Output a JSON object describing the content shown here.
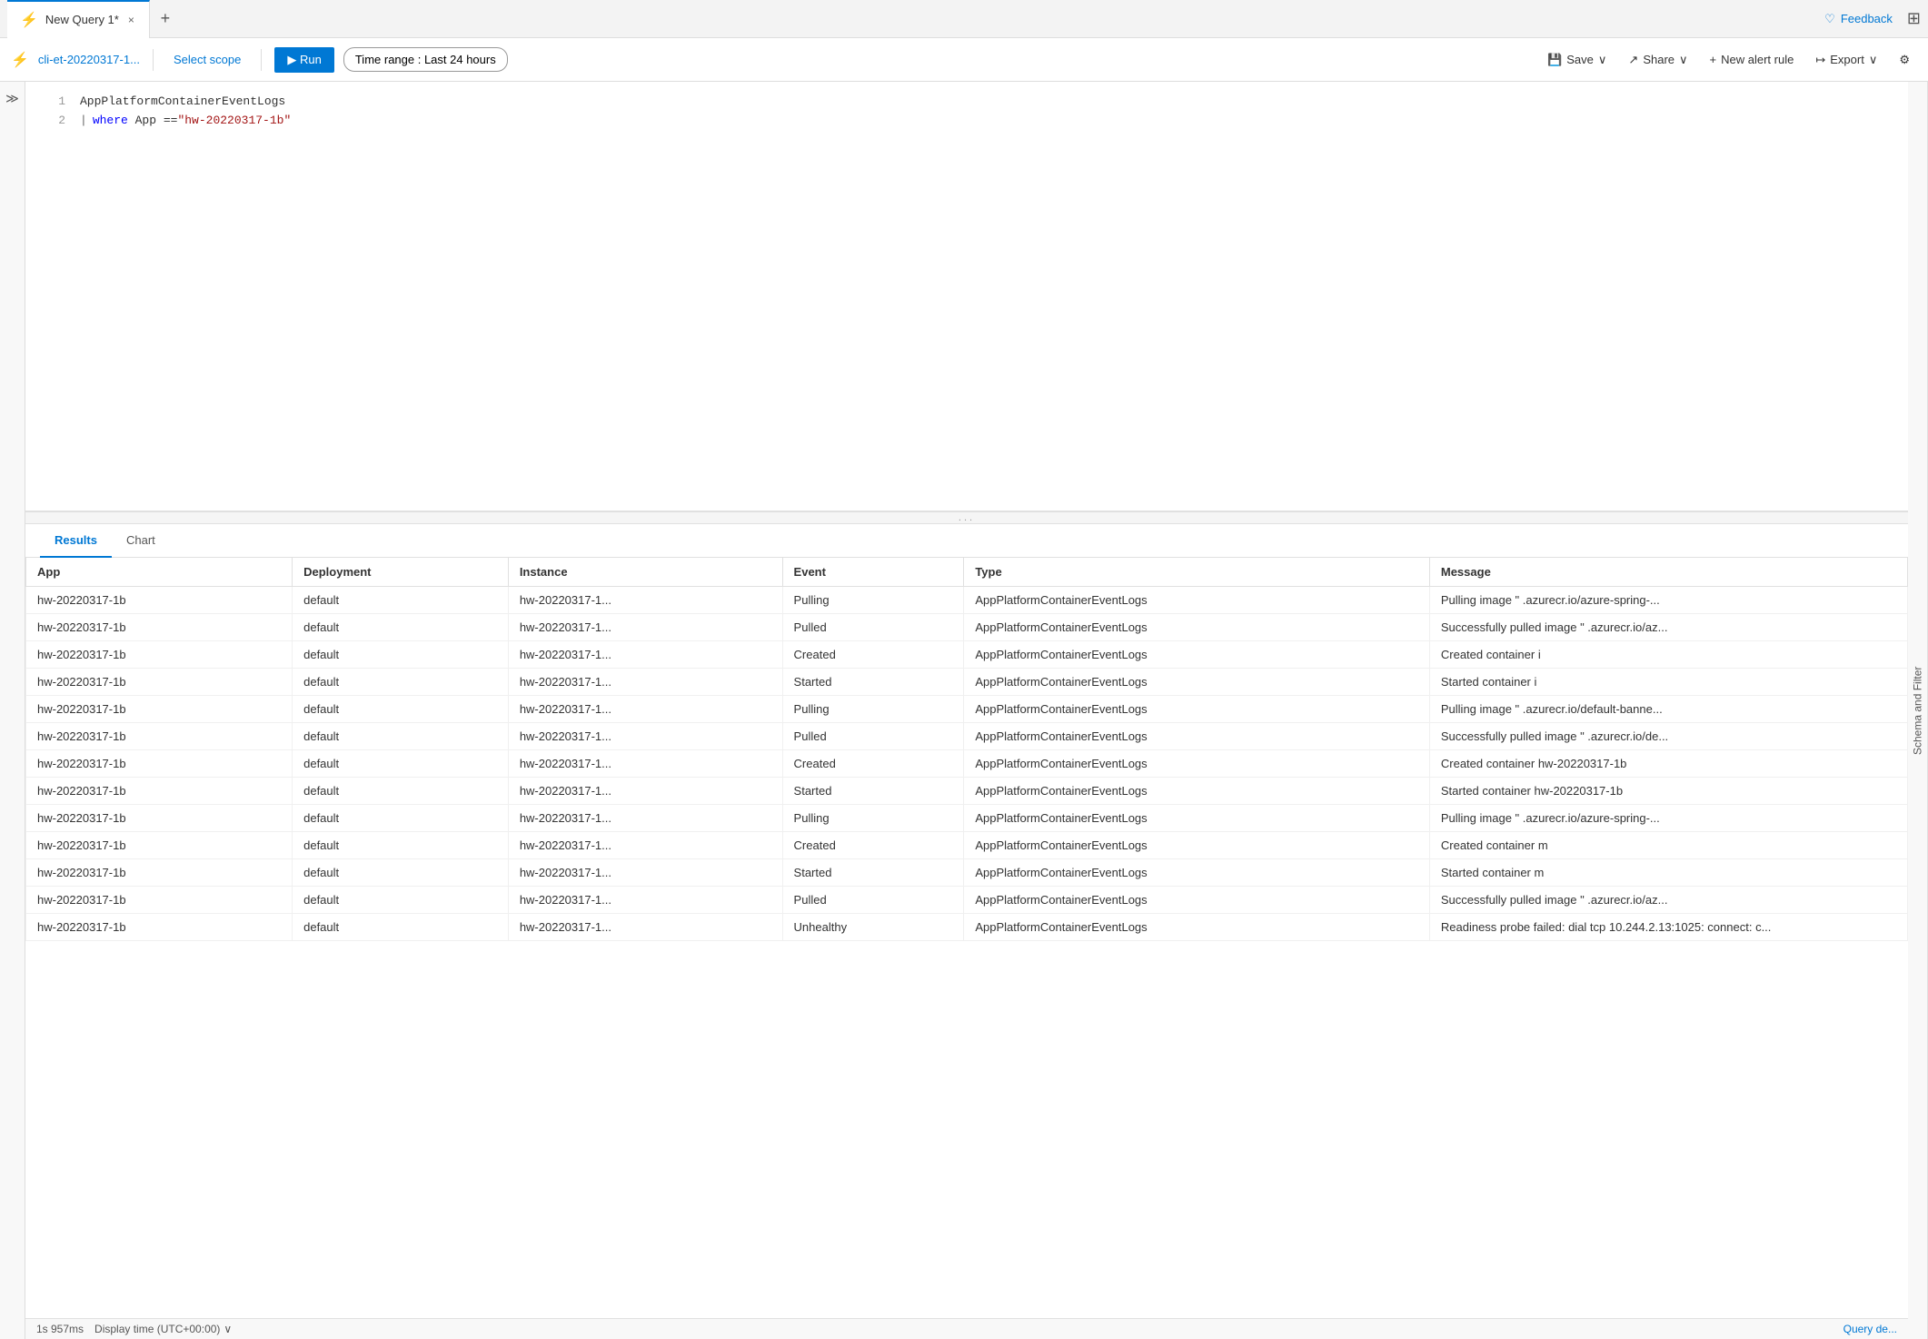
{
  "tab": {
    "icon": "⚡",
    "title": "New Query 1*",
    "close_label": "×"
  },
  "add_tab_label": "+",
  "feedback": {
    "icon": "♡",
    "label": "Feedback"
  },
  "grid_icon": "⊞",
  "toolbar": {
    "scope_icon": "⚡",
    "scope_name": "cli-et-20220317-1...",
    "select_scope_label": "Select scope",
    "run_label": "▶ Run",
    "time_range_label": "Time range : Last 24 hours",
    "save_label": "Save",
    "save_icon": "💾",
    "share_label": "Share",
    "share_icon": "↗",
    "new_alert_label": "New alert rule",
    "new_alert_icon": "+",
    "export_label": "Export",
    "export_icon": "↦",
    "filter_icon": "⚙"
  },
  "editor": {
    "lines": [
      {
        "num": "1",
        "content": "AppPlatformContainerEventLogs",
        "type": "plain"
      },
      {
        "num": "2",
        "content": "| where App == \"hw-20220317-1b\"",
        "type": "pipe"
      }
    ]
  },
  "resize_dots": "...",
  "results": {
    "tabs": [
      {
        "label": "Results",
        "active": true
      },
      {
        "label": "Chart",
        "active": false
      }
    ],
    "columns": [
      "App",
      "Deployment",
      "Instance",
      "Event",
      "Type",
      "Message"
    ],
    "rows": [
      {
        "App": "hw-20220317-1b",
        "Deployment": "default",
        "Instance": "hw-20220317-1...",
        "Event": "Pulling",
        "Type": "AppPlatformContainerEventLogs",
        "Message": "Pulling image \"  .azurecr.io/azure-spring-..."
      },
      {
        "App": "hw-20220317-1b",
        "Deployment": "default",
        "Instance": "hw-20220317-1...",
        "Event": "Pulled",
        "Type": "AppPlatformContainerEventLogs",
        "Message": "Successfully pulled image \"  .azurecr.io/az..."
      },
      {
        "App": "hw-20220317-1b",
        "Deployment": "default",
        "Instance": "hw-20220317-1...",
        "Event": "Created",
        "Type": "AppPlatformContainerEventLogs",
        "Message": "Created container i"
      },
      {
        "App": "hw-20220317-1b",
        "Deployment": "default",
        "Instance": "hw-20220317-1...",
        "Event": "Started",
        "Type": "AppPlatformContainerEventLogs",
        "Message": "Started container i"
      },
      {
        "App": "hw-20220317-1b",
        "Deployment": "default",
        "Instance": "hw-20220317-1...",
        "Event": "Pulling",
        "Type": "AppPlatformContainerEventLogs",
        "Message": "Pulling image \"  .azurecr.io/default-banne..."
      },
      {
        "App": "hw-20220317-1b",
        "Deployment": "default",
        "Instance": "hw-20220317-1...",
        "Event": "Pulled",
        "Type": "AppPlatformContainerEventLogs",
        "Message": "Successfully pulled image \"  .azurecr.io/de..."
      },
      {
        "App": "hw-20220317-1b",
        "Deployment": "default",
        "Instance": "hw-20220317-1...",
        "Event": "Created",
        "Type": "AppPlatformContainerEventLogs",
        "Message": "Created container hw-20220317-1b"
      },
      {
        "App": "hw-20220317-1b",
        "Deployment": "default",
        "Instance": "hw-20220317-1...",
        "Event": "Started",
        "Type": "AppPlatformContainerEventLogs",
        "Message": "Started container hw-20220317-1b"
      },
      {
        "App": "hw-20220317-1b",
        "Deployment": "default",
        "Instance": "hw-20220317-1...",
        "Event": "Pulling",
        "Type": "AppPlatformContainerEventLogs",
        "Message": "Pulling image \"  .azurecr.io/azure-spring-..."
      },
      {
        "App": "hw-20220317-1b",
        "Deployment": "default",
        "Instance": "hw-20220317-1...",
        "Event": "Created",
        "Type": "AppPlatformContainerEventLogs",
        "Message": "Created container m"
      },
      {
        "App": "hw-20220317-1b",
        "Deployment": "default",
        "Instance": "hw-20220317-1...",
        "Event": "Started",
        "Type": "AppPlatformContainerEventLogs",
        "Message": "Started container m"
      },
      {
        "App": "hw-20220317-1b",
        "Deployment": "default",
        "Instance": "hw-20220317-1...",
        "Event": "Pulled",
        "Type": "AppPlatformContainerEventLogs",
        "Message": "Successfully pulled image \"  .azurecr.io/az..."
      },
      {
        "App": "hw-20220317-1b",
        "Deployment": "default",
        "Instance": "hw-20220317-1...",
        "Event": "Unhealthy",
        "Type": "AppPlatformContainerEventLogs",
        "Message": "Readiness probe failed: dial tcp 10.244.2.13:1025: connect: c..."
      }
    ]
  },
  "statusbar": {
    "duration": "1s 957ms",
    "display_time_label": "Display time (UTC+00:00)",
    "dropdown_icon": "∨",
    "query_details_label": "Query de..."
  },
  "schema_label": "Schema and Filter"
}
